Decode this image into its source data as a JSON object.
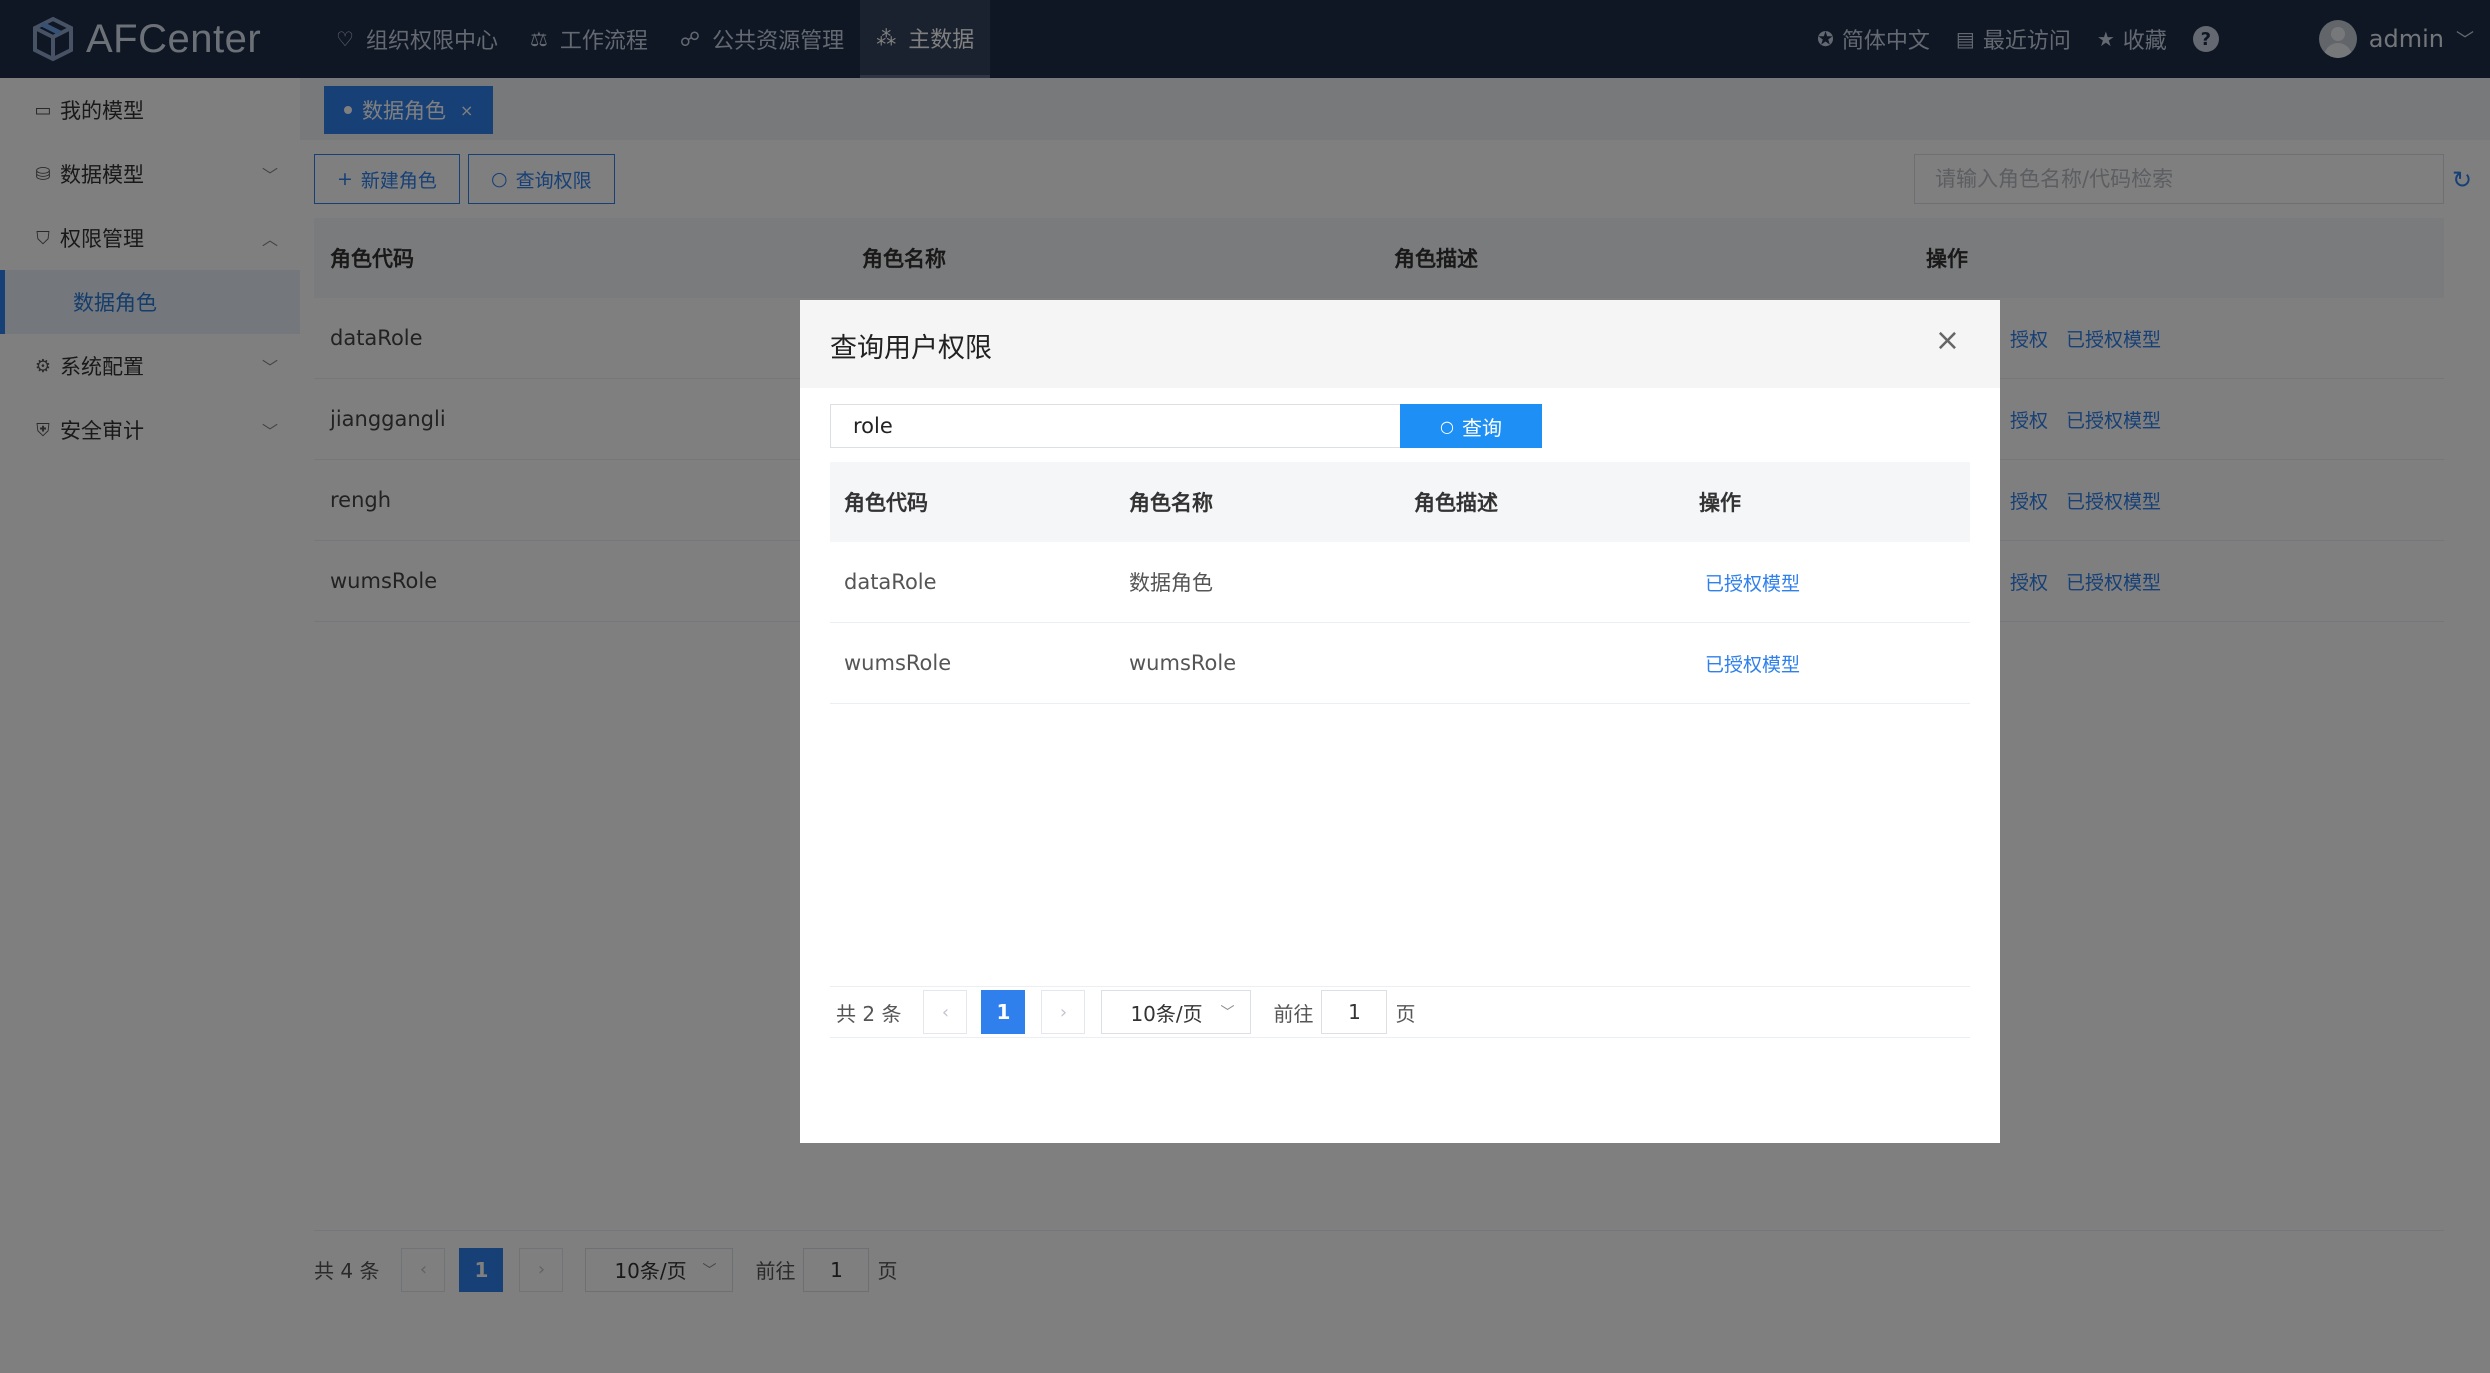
{
  "app": {
    "name": "AFCenter"
  },
  "nav": [
    {
      "label": "组织权限中心",
      "icon": "shield-icon",
      "glyph": "♡"
    },
    {
      "label": "工作流程",
      "icon": "scale-icon",
      "glyph": "⚖"
    },
    {
      "label": "公共资源管理",
      "icon": "users-icon",
      "glyph": "☍"
    },
    {
      "label": "主数据",
      "icon": "data-icon",
      "glyph": "⁂",
      "active": true
    }
  ],
  "header_right": {
    "language": "简体中文",
    "recent": "最近访问",
    "favorites": "收藏",
    "help": "?",
    "user": "admin"
  },
  "sidebar": {
    "items": [
      {
        "label": "我的模型"
      },
      {
        "label": "数据模型"
      },
      {
        "label": "权限管理"
      },
      {
        "label": "数据角色",
        "selected": true
      },
      {
        "label": "系统配置"
      },
      {
        "label": "安全审计"
      }
    ]
  },
  "tabs": [
    {
      "label": "数据角色",
      "close": "×"
    }
  ],
  "toolbar": {
    "new_role": "新建角色",
    "query_permission": "查询权限",
    "search_placeholder": "请输入角色名称/代码检索"
  },
  "table": {
    "headers": [
      "角色代码",
      "角色名称",
      "角色描述",
      "操作"
    ],
    "rows": [
      {
        "code": "dataRole"
      },
      {
        "code": "jianggangli"
      },
      {
        "code": "rengh"
      },
      {
        "code": "wumsRole"
      }
    ],
    "actions": {
      "grant": "授权",
      "granted_models": "已授权模型"
    }
  },
  "pagination": {
    "total": "共 4 条",
    "prev": "‹",
    "current": "1",
    "next": "›",
    "page_size": "10条/页",
    "goto_label": "前往",
    "goto_value": "1",
    "page_unit": "页"
  },
  "modal": {
    "title": "查询用户权限",
    "close": "×",
    "search_value": "role",
    "search_button": "查询",
    "headers": [
      "角色代码",
      "角色名称",
      "角色描述",
      "操作"
    ],
    "rows": [
      {
        "code": "dataRole",
        "name": "数据角色",
        "desc": "",
        "action": "已授权模型"
      },
      {
        "code": "wumsRole",
        "name": "wumsRole",
        "desc": "",
        "action": "已授权模型"
      }
    ],
    "pagination": {
      "total": "共 2 条",
      "prev": "‹",
      "current": "1",
      "next": "›",
      "page_size": "10条/页",
      "goto_label": "前往",
      "goto_value": "1",
      "page_unit": "页"
    }
  },
  "colors": {
    "header_bg": "#1f2e4a",
    "primary": "#2f80ed",
    "search_button": "#1e8ff5"
  }
}
